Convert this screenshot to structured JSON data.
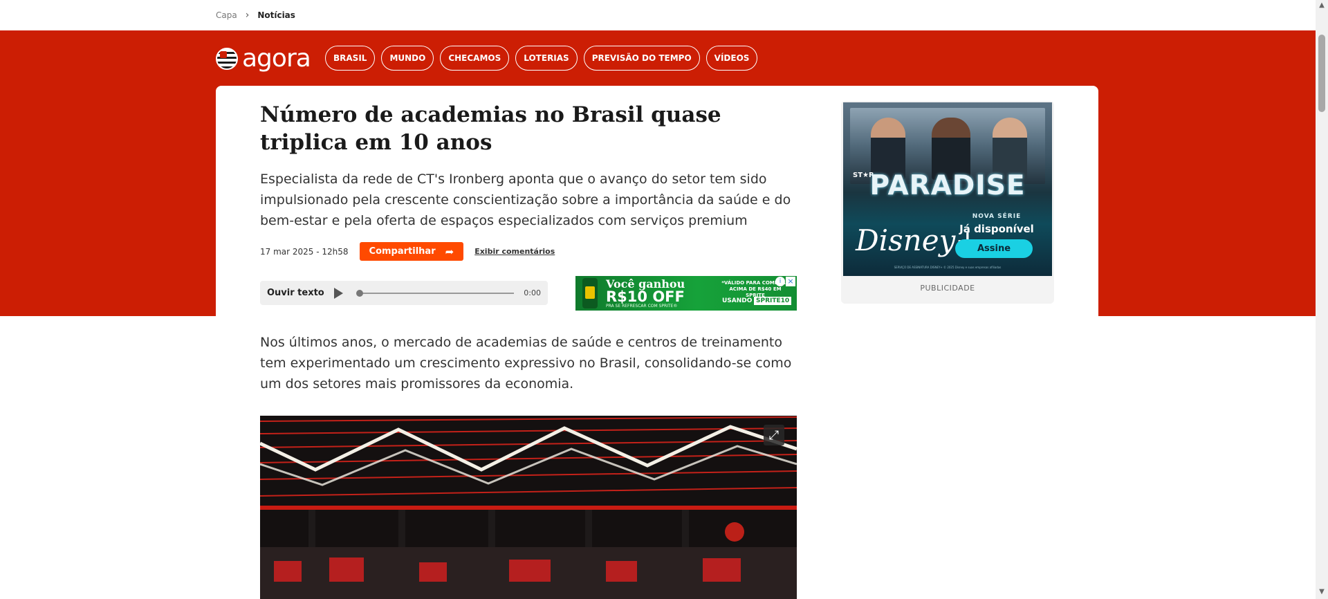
{
  "breadcrumb": {
    "home": "Capa",
    "separator": "›",
    "current": "Notícias"
  },
  "header": {
    "logo_text": "agora",
    "nav": [
      "BRASIL",
      "MUNDO",
      "CHECAMOS",
      "LOTERIAS",
      "PREVISÃO DO TEMPO",
      "VÍDEOS"
    ],
    "brand_color": "#cc1e04"
  },
  "article": {
    "title": "Número de academias no Brasil quase triplica em 10 anos",
    "subtitle": "Especialista da rede de CT's Ironberg aponta que o avanço do setor tem sido impulsionado pela crescente conscientização sobre a importância da saúde e do bem-estar e pela oferta de espaços especializados com serviços premium",
    "date": "17 mar 2025 - 12h58",
    "share_label": "Compartilhar",
    "share_icon": "share-arrow-icon",
    "comments_label": "Exibir comentários",
    "audio": {
      "label": "Ouvir texto",
      "time": "0:00",
      "progress": 0
    },
    "paragraph": "Nos últimos anos, o mercado de academias de saúde e centros de treinamento tem experimentado um crescimento expressivo no Brasil, consolidando-se como um dos setores mais promissores da economia.",
    "image_alt_icon": "expand-icon"
  },
  "ads": {
    "sprite": {
      "headline": "Você ganhou",
      "amount": "R$10 OFF",
      "small": "PRA SE REFRESCAR COM SPRITE®",
      "right_text": "*VÁLIDO PARA COMPRAS ACIMA DE R$40 EM SPRITE",
      "coupon_label": "USANDO O CUPOM",
      "coupon_code": "SPRITE10",
      "close_icon": "×",
      "info_icon": "i"
    },
    "paradise": {
      "brand": "ST★R",
      "title": "PARADISE",
      "disney": "Disney+",
      "nova_serie": "NOVA SÉRIE",
      "available": "Já disponível",
      "cta": "Assine",
      "fine_print": "SERVIÇO DE ASSINATURA DISNEY+ © 2025 Disney e suas empresas afiliadas"
    },
    "label": "PUBLICIDADE"
  },
  "scrollbar": {
    "up": "▲",
    "down": "▼"
  }
}
